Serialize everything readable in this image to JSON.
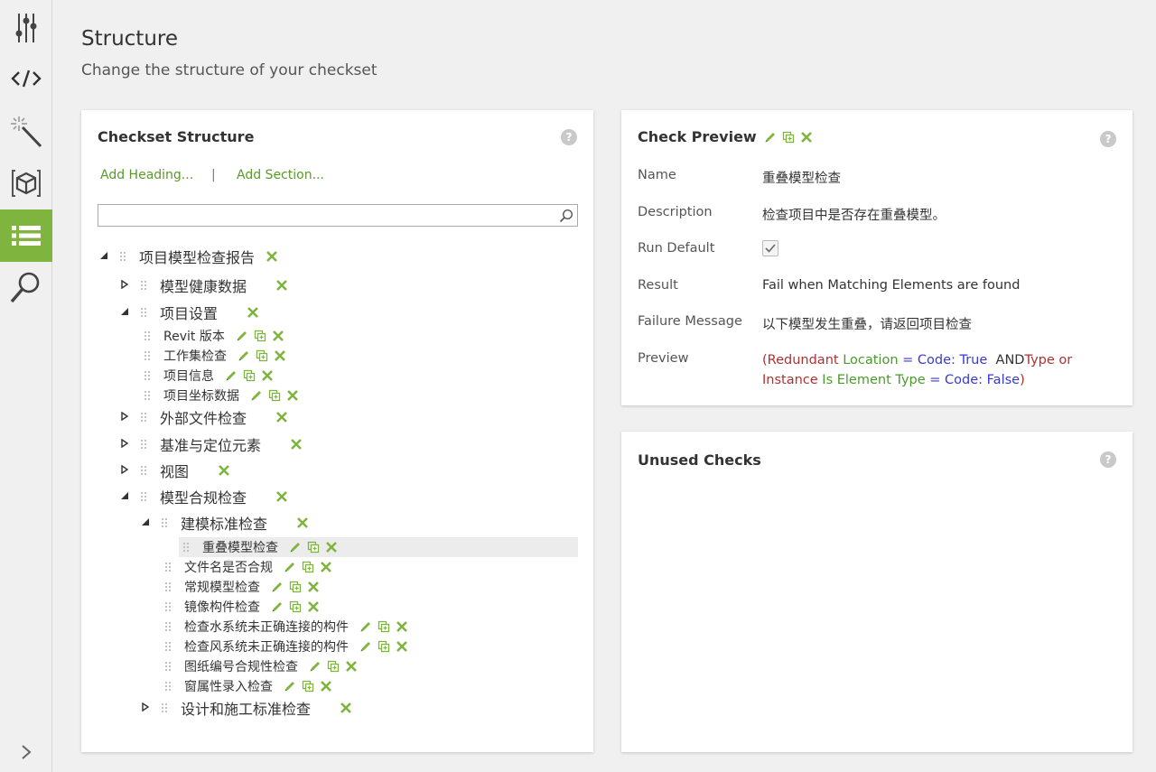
{
  "header": {
    "title": "Structure",
    "subtitle": "Change the structure of your checkset"
  },
  "colors": {
    "accent": "#7fb53f",
    "link": "#5b9a2a"
  },
  "rail": {
    "icons": [
      "sliders-icon",
      "code-icon",
      "magic-wand-icon",
      "cube-icon",
      "list-icon",
      "search-icon"
    ],
    "active": "list-icon"
  },
  "structure": {
    "title": "Checkset Structure",
    "add_heading": "Add Heading...",
    "separator": "|",
    "add_section": "Add Section...",
    "search_placeholder": "",
    "tree": [
      {
        "label": "项目模型检查报告",
        "type": "heading",
        "level": 0,
        "toggle": "expanded"
      },
      {
        "label": "模型健康数据",
        "type": "section",
        "level": 1,
        "toggle": "collapsed"
      },
      {
        "label": "项目设置",
        "type": "section",
        "level": 1,
        "toggle": "expanded"
      },
      {
        "label": "Revit 版本",
        "type": "check",
        "level": 2
      },
      {
        "label": "工作集检查",
        "type": "check",
        "level": 2
      },
      {
        "label": "项目信息",
        "type": "check",
        "level": 2
      },
      {
        "label": "项目坐标数据",
        "type": "check",
        "level": 2
      },
      {
        "label": "外部文件检查",
        "type": "section",
        "level": 1,
        "toggle": "collapsed"
      },
      {
        "label": "基准与定位元素",
        "type": "section",
        "level": 1,
        "toggle": "collapsed"
      },
      {
        "label": "视图",
        "type": "section",
        "level": 1,
        "toggle": "collapsed"
      },
      {
        "label": "模型合规检查",
        "type": "section",
        "level": 1,
        "toggle": "expanded"
      },
      {
        "label": "建模标准检查",
        "type": "section",
        "level": 2,
        "toggle": "expanded"
      },
      {
        "label": "重叠模型检查",
        "type": "check",
        "level": 3,
        "selected": true
      },
      {
        "label": "文件名是否合规",
        "type": "check",
        "level": 3
      },
      {
        "label": "常规模型检查",
        "type": "check",
        "level": 3
      },
      {
        "label": "镜像构件检查",
        "type": "check",
        "level": 3
      },
      {
        "label": "检查水系统未正确连接的构件",
        "type": "check",
        "level": 3
      },
      {
        "label": "检查风系统未正确连接的构件",
        "type": "check",
        "level": 3
      },
      {
        "label": "图纸编号合规性检查",
        "type": "check",
        "level": 3
      },
      {
        "label": "窗属性录入检查",
        "type": "check",
        "level": 3
      },
      {
        "label": "设计和施工标准检查",
        "type": "section",
        "level": 2,
        "toggle": "collapsed"
      }
    ]
  },
  "preview": {
    "title": "Check Preview",
    "fields": {
      "name_label": "Name",
      "name_value": "重叠模型检查",
      "description_label": "Description",
      "description_value": "检查项目中是否存在重叠模型。",
      "run_default_label": "Run Default",
      "run_default_checked": true,
      "result_label": "Result",
      "result_value": "Fail when Matching Elements are found",
      "failure_label": "Failure Message",
      "failure_value": "以下模型发生重叠，请返回项目检查",
      "preview_label": "Preview"
    },
    "expression": {
      "open": "(",
      "field1": "Redundant",
      "crit1": "Location",
      "op1": "= Code: True",
      "and": "AND",
      "field2": "Type or",
      "field2b": "Instance",
      "crit2": "Is Element Type",
      "op2": "= Code: False",
      "close": ")"
    }
  },
  "unused": {
    "title": "Unused Checks"
  },
  "help_glyph": "?"
}
